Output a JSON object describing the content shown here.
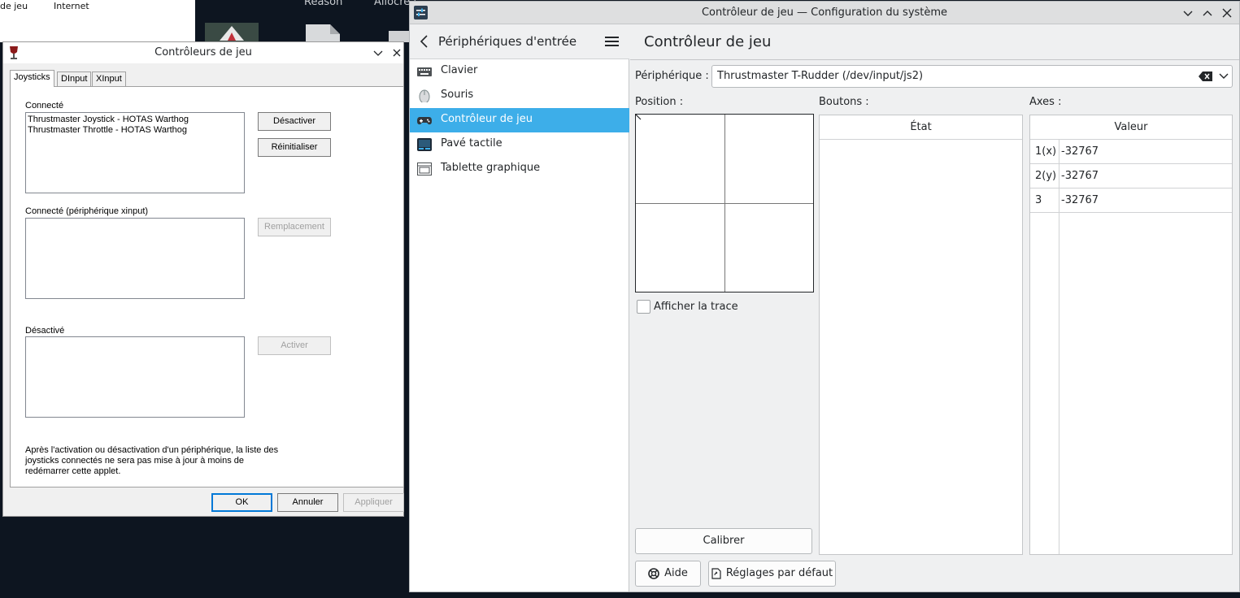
{
  "background": {
    "file_window": {
      "col1": "de jeu",
      "col2": "Internet"
    },
    "desktop_labels": [
      "Reason",
      "Allocrea"
    ]
  },
  "wine_dialog": {
    "title": "Contrôleurs de jeu",
    "tabs": [
      "Joysticks",
      "DInput",
      "XInput"
    ],
    "connected_label": "Connecté",
    "connected_items": [
      "Thrustmaster Joystick - HOTAS Warthog",
      "Thrustmaster Throttle - HOTAS Warthog"
    ],
    "disable_label": "Désactiver",
    "reset_label": "Réinitialiser",
    "xinput_label": "Connecté (périphérique xinput)",
    "override_label": "Remplacement",
    "disabled_label": "Désactivé",
    "enable_label": "Activer",
    "note": "Après l'activation ou désactivation d'un périphérique, la liste des joysticks connectés ne sera pas mise à jour à moins de redémarrer cette applet.",
    "ok": "OK",
    "cancel": "Annuler",
    "apply": "Appliquer"
  },
  "kde": {
    "title": "Contrôleur de jeu — Configuration du système",
    "sidebar": {
      "header": "Périphériques d'entrée",
      "items": [
        {
          "label": "Clavier",
          "icon": "keyboard-icon"
        },
        {
          "label": "Souris",
          "icon": "mouse-icon"
        },
        {
          "label": "Contrôleur de jeu",
          "icon": "gamepad-icon",
          "active": true
        },
        {
          "label": "Pavé tactile",
          "icon": "touchpad-icon"
        },
        {
          "label": "Tablette graphique",
          "icon": "tablet-icon"
        }
      ]
    },
    "page_title": "Contrôleur de jeu",
    "device_label": "Périphérique :",
    "device_value": "Thrustmaster T-Rudder (/dev/input/js2)",
    "position_label": "Position :",
    "buttons_label": "Boutons :",
    "axes_label": "Axes :",
    "buttons_header": "État",
    "axes_header": "Valeur",
    "axes": [
      {
        "id": "1(x)",
        "value": "-32767"
      },
      {
        "id": "2(y)",
        "value": "-32767"
      },
      {
        "id": "3",
        "value": "-32767"
      }
    ],
    "show_trace_label": "Afficher la trace",
    "calibrate_label": "Calibrer",
    "help_label": "Aide",
    "defaults_label": "Réglages par défaut"
  },
  "colors": {
    "accent": "#3daee9",
    "desktop": "#0d1520"
  }
}
